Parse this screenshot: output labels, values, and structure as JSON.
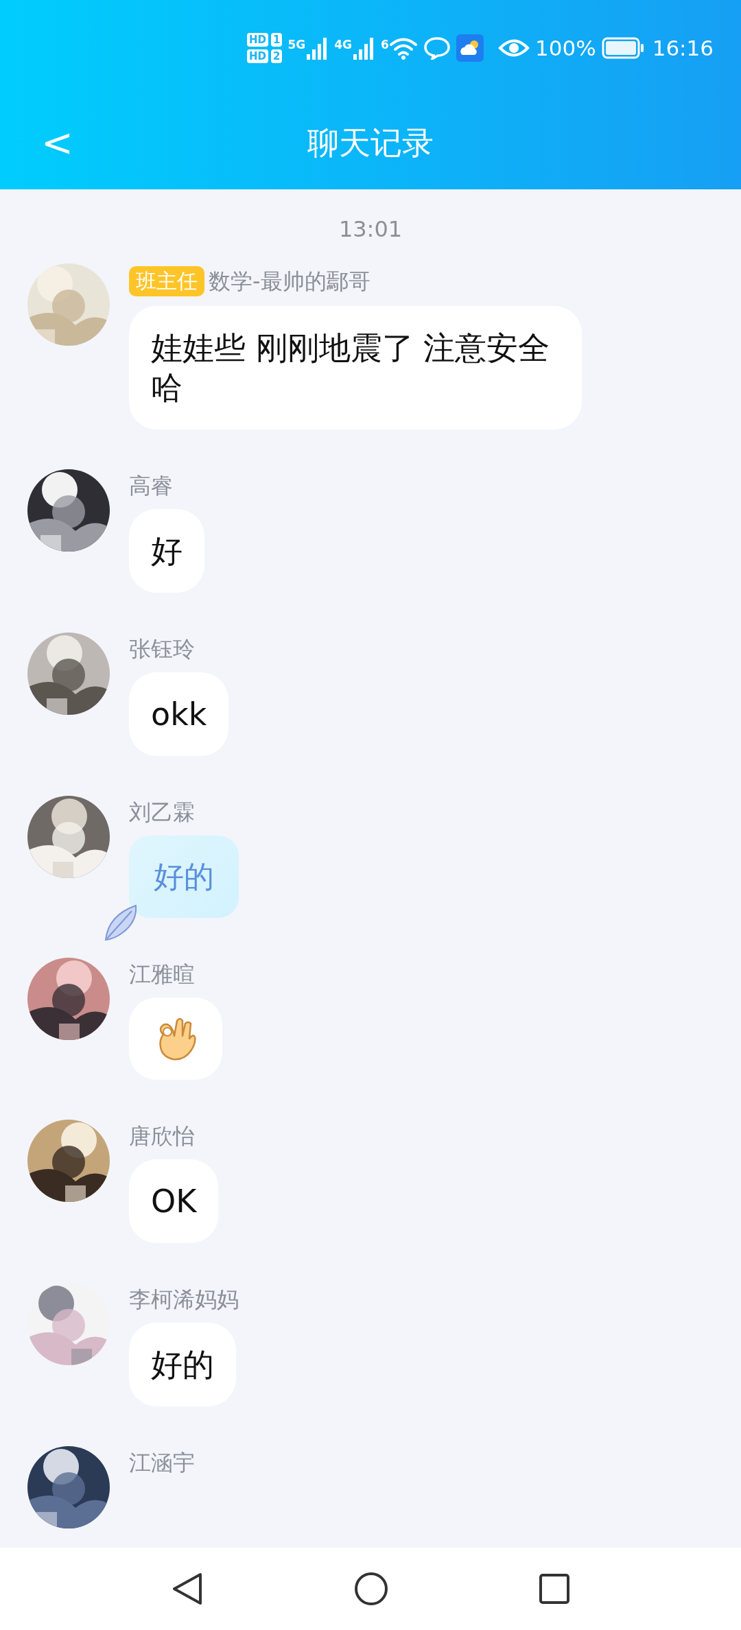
{
  "status_bar": {
    "sim_1": "1",
    "sim_2": "2",
    "hd_1": "HD",
    "hd_2": "HD",
    "net_1": "5G",
    "net_2": "4G",
    "wifi": "6",
    "battery": "100%",
    "time": "16:16"
  },
  "header": {
    "back": "<",
    "title": "聊天记录"
  },
  "timestamp": "13:01",
  "messages": [
    {
      "sender": "数学-最帅的鄢哥",
      "role": "班主任",
      "kind": "text",
      "text": "娃娃些 刚刚地震了 注意安全哈"
    },
    {
      "sender": "高睿",
      "kind": "text",
      "text": "好"
    },
    {
      "sender": "张钰玲",
      "kind": "text",
      "text": "okk"
    },
    {
      "sender": "刘乙霖",
      "kind": "styled",
      "text": "好的"
    },
    {
      "sender": "江雅暄",
      "kind": "sticker"
    },
    {
      "sender": "唐欣怡",
      "kind": "text",
      "text": "OK"
    },
    {
      "sender": "李柯浠妈妈",
      "kind": "text",
      "text": "好的"
    },
    {
      "sender": "江涵宇",
      "kind": "cut"
    }
  ]
}
